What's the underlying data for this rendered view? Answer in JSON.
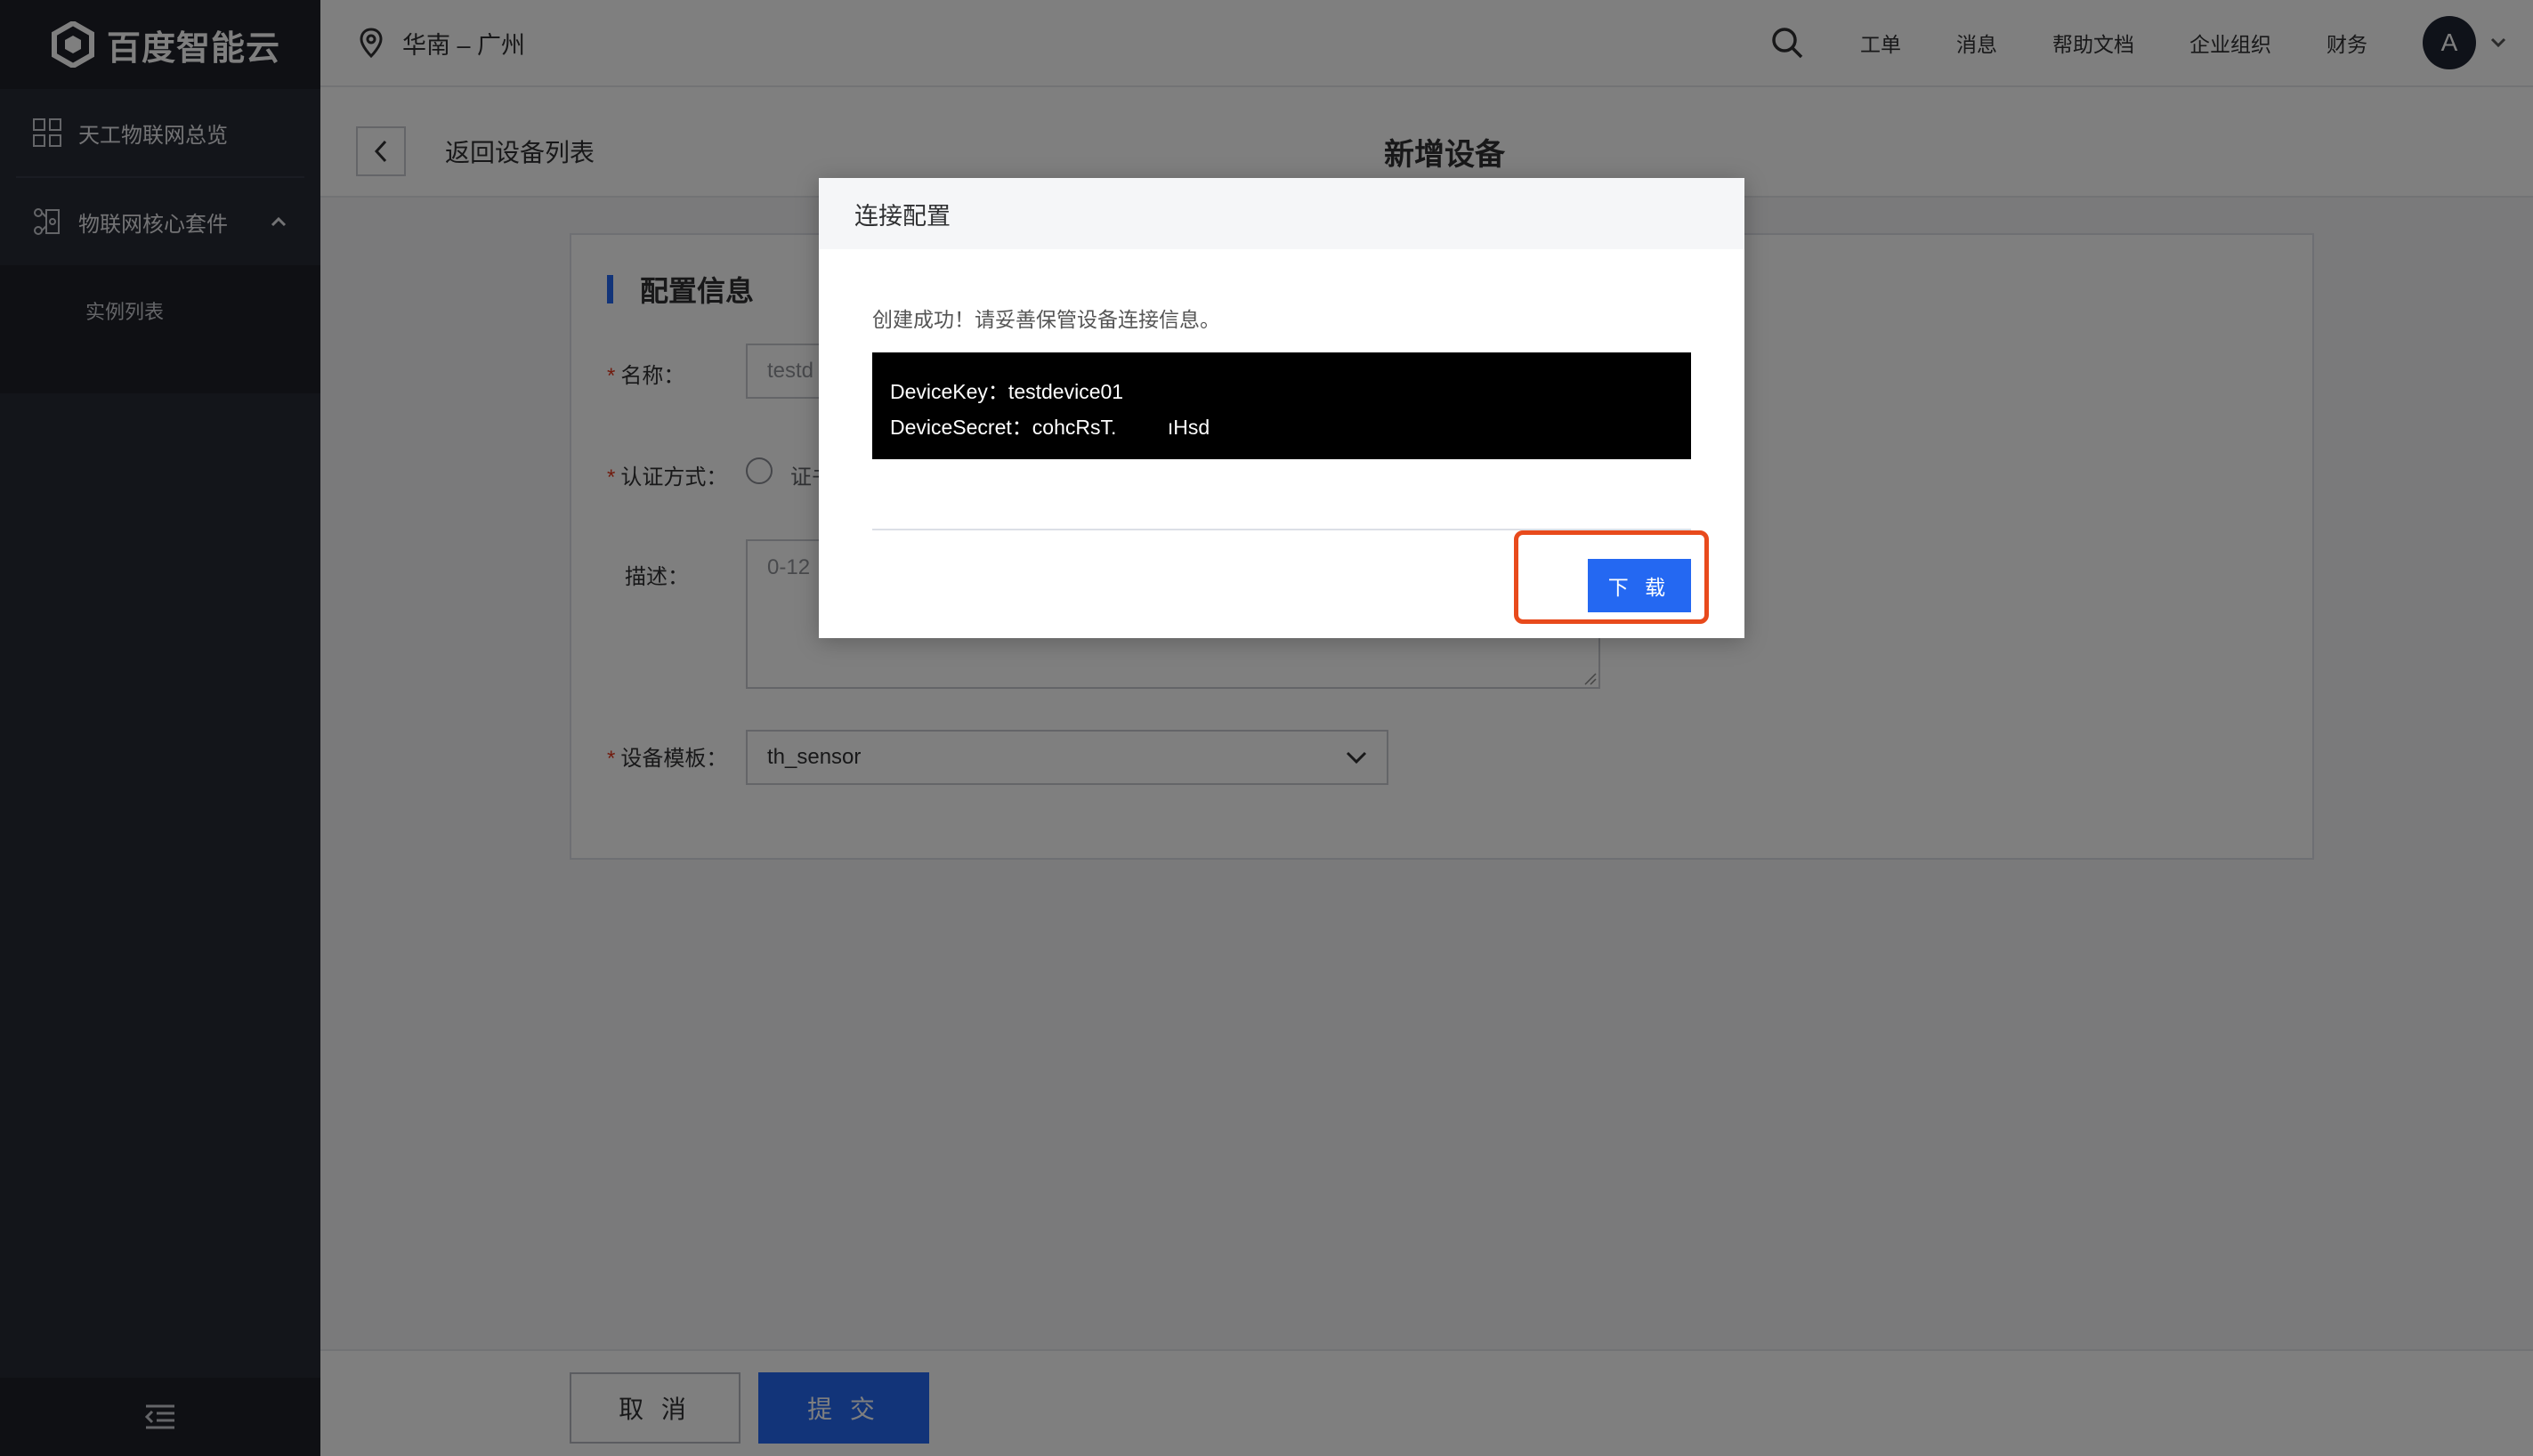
{
  "brand": {
    "logo_text": "百度智能云"
  },
  "sidebar": {
    "items": [
      {
        "label": "天工物联网总览",
        "icon": "grid-icon"
      },
      {
        "label": "物联网核心套件",
        "icon": "hub-icon",
        "expanded": true
      }
    ],
    "sub_items": [
      {
        "label": "实例列表"
      }
    ]
  },
  "topbar": {
    "region": "华南 – 广州",
    "links": [
      "工单",
      "消息",
      "帮助文档",
      "企业组织",
      "财务"
    ],
    "avatar_initial": "A"
  },
  "page": {
    "back_label": "返回设备列表",
    "title": "新增设备"
  },
  "form": {
    "section_title": "配置信息",
    "name_label": "名称：",
    "name_value": "testd",
    "auth_label": "认证方式：",
    "auth_option_partial": "证书",
    "desc_label": "描述：",
    "desc_placeholder": "0-12",
    "template_label": "设备模板：",
    "template_value": "th_sensor"
  },
  "footer": {
    "cancel_label": "取 消",
    "submit_label": "提 交"
  },
  "modal": {
    "title": "连接配置",
    "message": "创建成功！请妥善保管设备连接信息。",
    "device_key_line": "DeviceKey：testdevice01",
    "device_secret_line": "DeviceSecret：cohcRsT.         ıHsd",
    "download_label": "下 载"
  },
  "colors": {
    "primary": "#2468f2",
    "highlight": "#e84a1c",
    "sidebar": "#262a34"
  }
}
